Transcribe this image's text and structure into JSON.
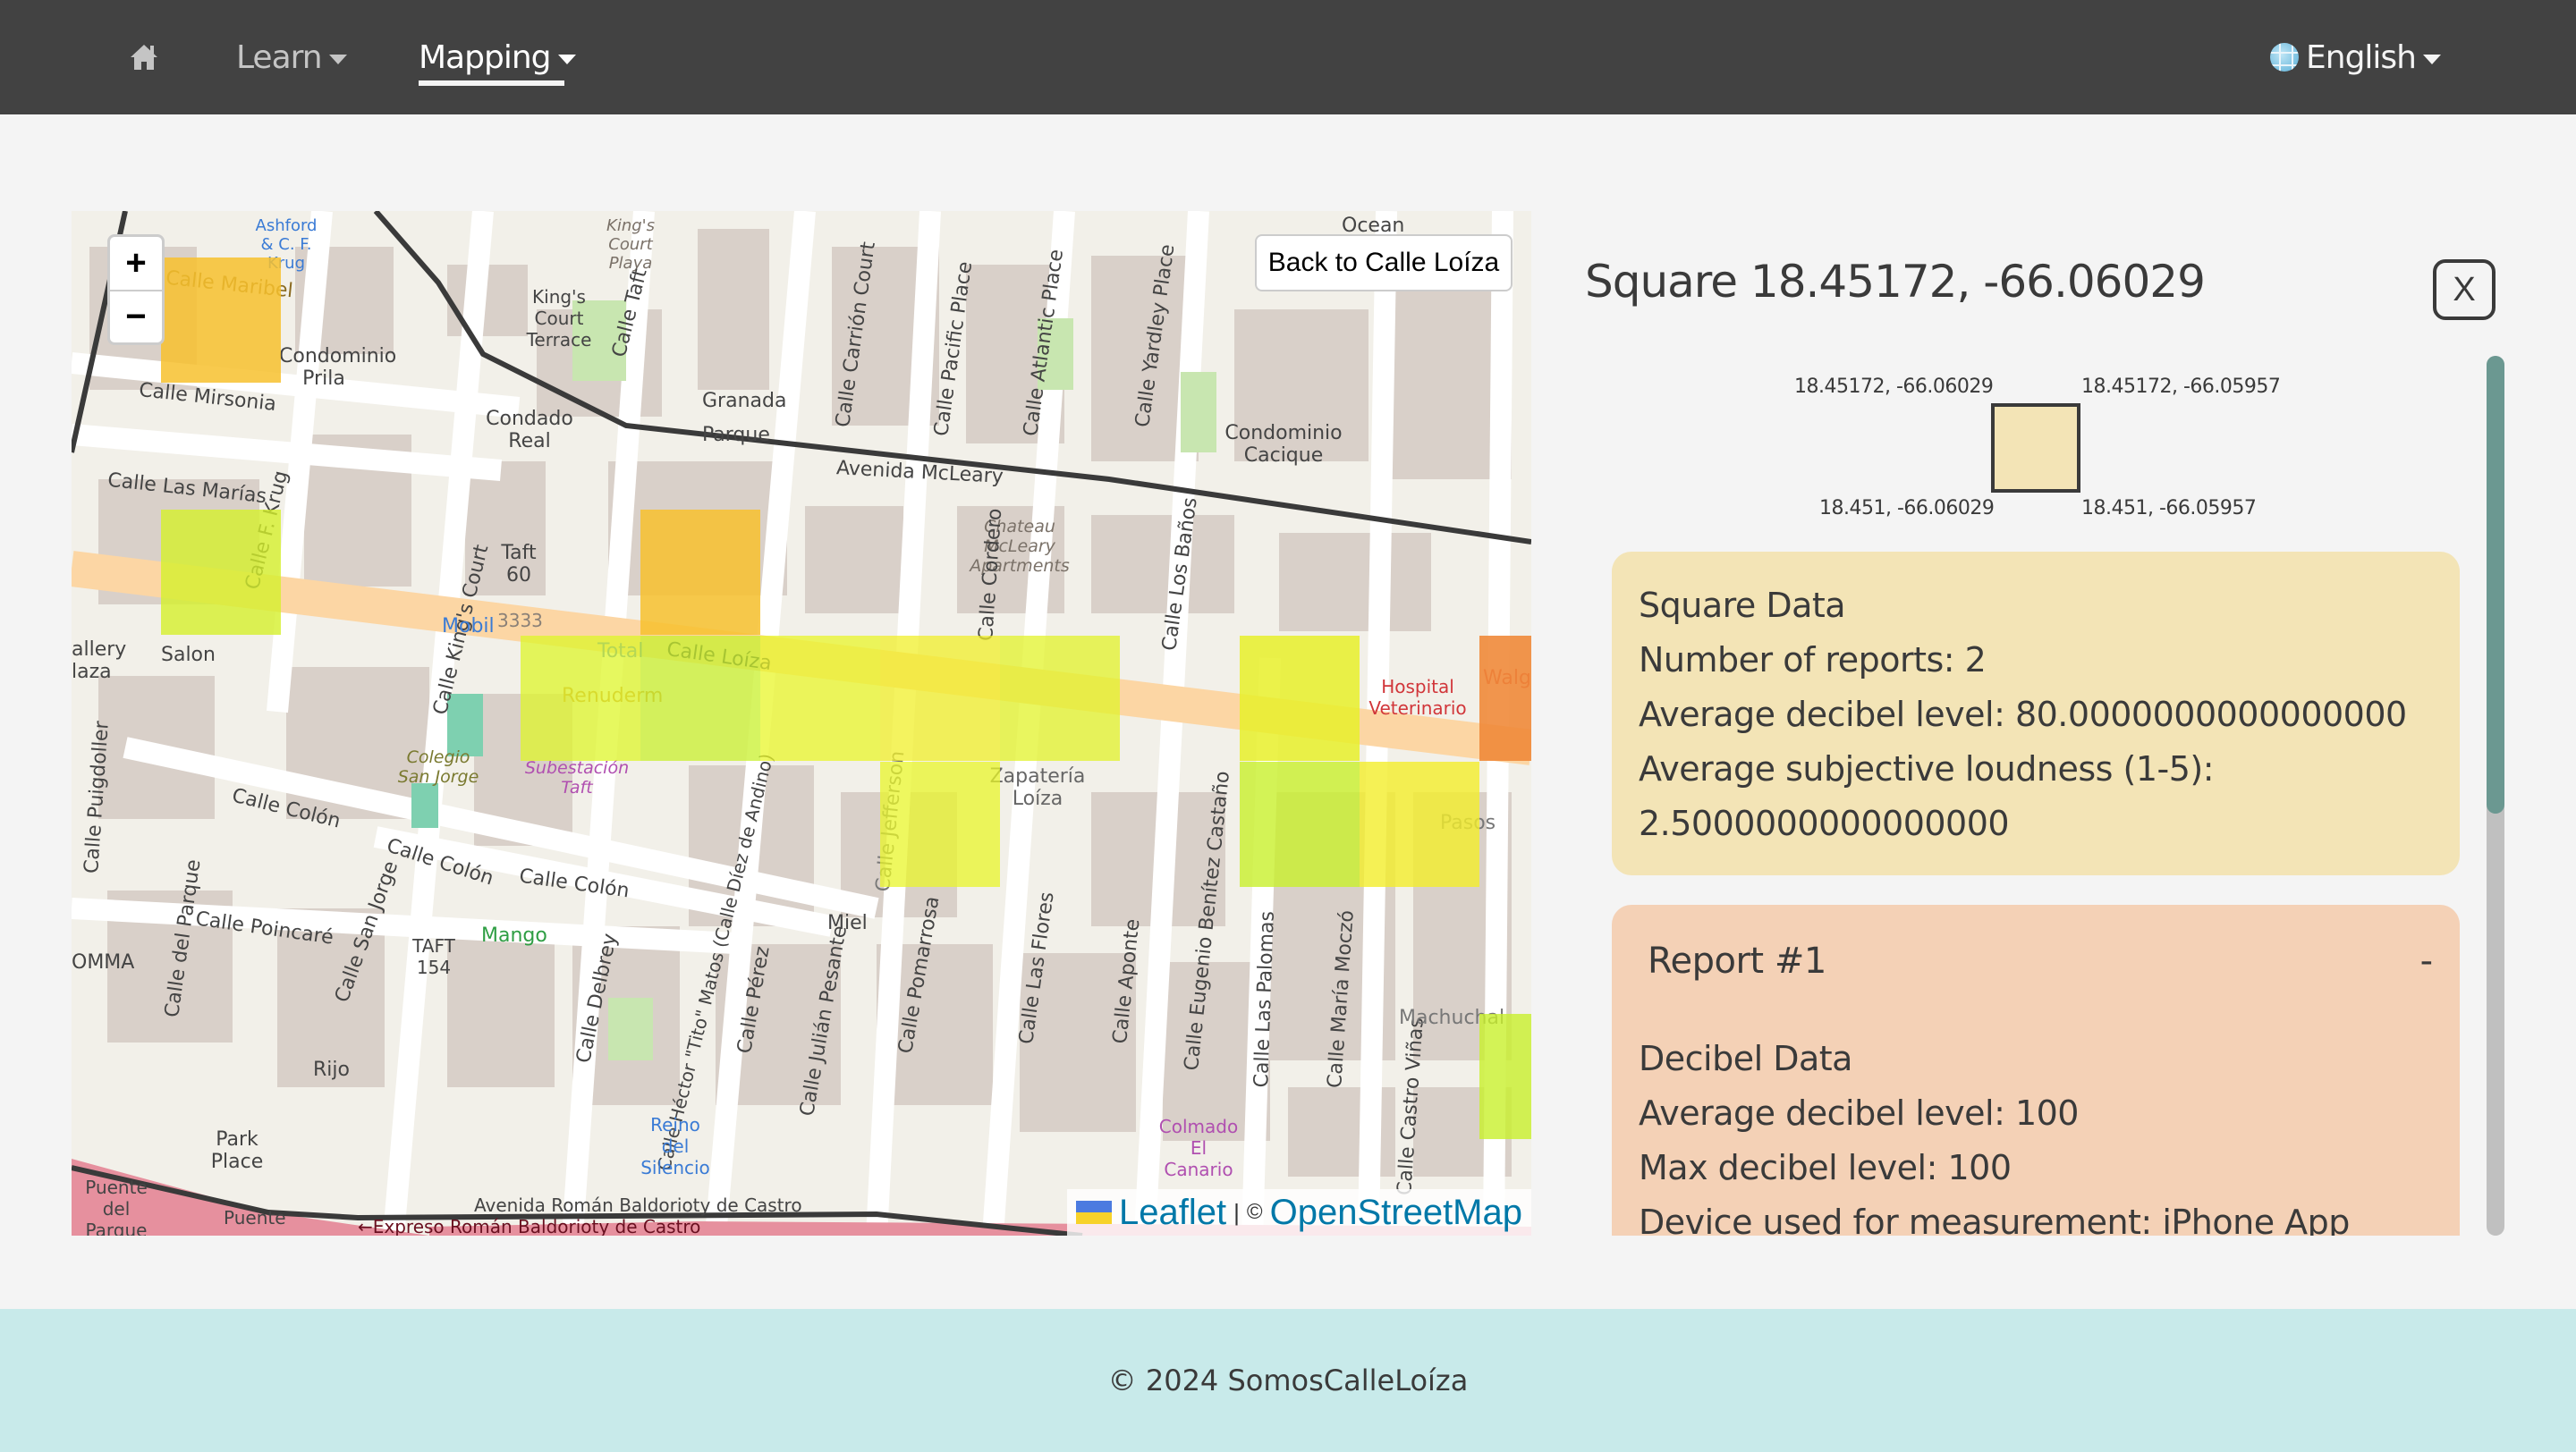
{
  "nav": {
    "home_icon": "home-icon",
    "items": [
      {
        "label": "Learn",
        "active": false
      },
      {
        "label": "Mapping",
        "active": true
      }
    ],
    "language": {
      "label": "English",
      "icon": "globe-icon"
    }
  },
  "map": {
    "zoom_in_label": "+",
    "zoom_out_label": "−",
    "back_button_label": "Back to Calle Loíza",
    "attribution": {
      "leaflet": "Leaflet",
      "separator": "|",
      "copyright": "©",
      "osm": "OpenStreetMap"
    },
    "labels": {
      "calle_maribel": "Calle Maribel",
      "calle_mirsonia": "Calle Mirsonia",
      "calle_las_marias": "Calle Las Marías",
      "calle_f_krug": "Calle F. Krug",
      "condominio_prila": "Condominio Prila",
      "condado_real": "Condado Real",
      "calle_kings_court": "Calle King's Court",
      "kings_court_terrace": "King's Court Terrace",
      "kings_court_playa": "King's Court Playa",
      "calle_taft": "Calle Taft",
      "granada": "Granada",
      "parque": "Parque",
      "avenida_mcleary": "Avenida McLeary",
      "calle_carrion_court": "Calle Carrión Court",
      "calle_pacific_place": "Calle Pacific Place",
      "calle_atlantic_place": "Calle Atlantic Place",
      "calle_yardley_place": "Calle Yardley Place",
      "condominio_cacique": "Condominio Cacique",
      "chateau_mcleary": "Chateau McLeary Apartments",
      "calle_cordero": "Calle Cordero",
      "calle_los_banos": "Calle Los Baños",
      "calle_loiza": "Calle Loíza",
      "mobil": "Mobil",
      "total": "Total",
      "renuderm": "Renuderm",
      "subestacion_taft": "Subestación Taft",
      "colegio_san_jorge": "Colegio San Jorge",
      "hospital_veterinario": "Hospital Veterinario",
      "walgreens": "Walgr",
      "calle_colon": "Calle Colón",
      "calle_poincare": "Calle Poincaré",
      "calle_del_parque": "Calle del Parque",
      "calle_san_jorge": "Calle San Jorge",
      "calle_puigdoller": "Calle Puigdoller",
      "calle_delbrey": "Calle Delbrey",
      "calle_hector_matos": "Calle Héctor \"Tito\" Matos (Calle Díez de Andino)",
      "calle_perez": "Calle Pérez",
      "calle_julian_pesante": "Calle Julián Pesante",
      "calle_jefferson": "Calle Jefferson",
      "calle_pomarrosa": "Calle Pomarrosa",
      "calle_las_flores": "Calle Las Flores",
      "calle_aponte": "Calle Aponte",
      "calle_eugenio_benitez": "Calle Eugenio Benítez Castaño",
      "calle_las_palomas": "Calle Las Palomas",
      "calle_maria_moczo": "Calle María Moczó",
      "calle_castro_vinas": "Calle Castro Viñas",
      "zapateria_loiza": "Zapatería Loíza",
      "pasos": "Pasos",
      "machuchal": "Machuchal",
      "miel": "Miel",
      "mango": "Mango",
      "taft_154": "TAFT 154",
      "rijo": "Rijo",
      "park_place": "Park Place",
      "reino_del_silencio": "Reino del Silencio",
      "colmado_el_canario": "Colmado El Canario",
      "puente_del_parque": "Puente del Parque",
      "puente": "Puente",
      "avenida_baldorioty": "Avenida Román Baldorioty de Castro",
      "expreso_baldorioty": "←Expreso Román Baldorioty de Castro",
      "salon": "Salon",
      "gallery_plaza": "allery laza",
      "ashford": "Ashford & C. F. Krug",
      "ocean": "Ocean",
      "komma": "OMMA",
      "taft_60": "Taft 60",
      "num_3333": "3333"
    },
    "squares": [
      {
        "lat": "row0",
        "color": "#f7c12e",
        "opacity": 0.85,
        "col": 0,
        "row": 0
      },
      {
        "color": "#d4f02c",
        "opacity": 0.8,
        "col": 0,
        "row": 2
      },
      {
        "color": "#f7c12e",
        "opacity": 0.85,
        "col": 4,
        "row": 2
      },
      {
        "color": "#ddf52a",
        "opacity": 0.75,
        "col": 3,
        "row": 3
      },
      {
        "color": "#c8f02c",
        "opacity": 0.75,
        "col": 4,
        "row": 3
      },
      {
        "color": "#e8f52a",
        "opacity": 0.75,
        "col": 5,
        "row": 3
      },
      {
        "color": "#f0ef2a",
        "opacity": 0.75,
        "col": 6,
        "row": 3
      },
      {
        "color": "#e2f32a",
        "opacity": 0.75,
        "col": 7,
        "row": 3
      },
      {
        "color": "#e8f52a",
        "opacity": 0.75,
        "col": 6,
        "row": 4
      },
      {
        "color": "#e8f02a",
        "opacity": 0.85,
        "col": 9,
        "row": 3
      },
      {
        "color": "#f08a3a",
        "opacity": 0.9,
        "col": 11,
        "row": 3
      },
      {
        "color": "#c8f02c",
        "opacity": 0.8,
        "col": 9,
        "row": 4
      },
      {
        "color": "#f2ee2a",
        "opacity": 0.8,
        "col": 10,
        "row": 4
      },
      {
        "color": "#c8f02c",
        "opacity": 0.8,
        "col": 11,
        "row": 6
      }
    ]
  },
  "panel": {
    "title": "Square 18.45172, -66.06029",
    "close_label": "X",
    "corners": {
      "top_left": "18.45172, -66.06029",
      "top_right": "18.45172, -66.05957",
      "bottom_left": "18.451, -66.06029",
      "bottom_right": "18.451, -66.05957"
    },
    "square_color": "#f3e4b6",
    "square_data": {
      "heading": "Square Data",
      "num_reports": "Number of reports: 2",
      "avg_decibel": "Average decibel level: 80.0000000000000000",
      "avg_loudness_label": "Average subjective loudness (1-5):",
      "avg_loudness_value": "2.5000000000000000"
    },
    "reports": [
      {
        "title": "Report #1",
        "toggle": "-",
        "section": "Decibel Data",
        "avg_decibel": "Average decibel level: 100",
        "max_decibel": "Max decibel level: 100",
        "device": "Device used for measurement: iPhone App"
      }
    ],
    "scroll_fraction_visible": 0.52
  },
  "footer": {
    "text": "© 2024 SomosCalleLoíza"
  }
}
